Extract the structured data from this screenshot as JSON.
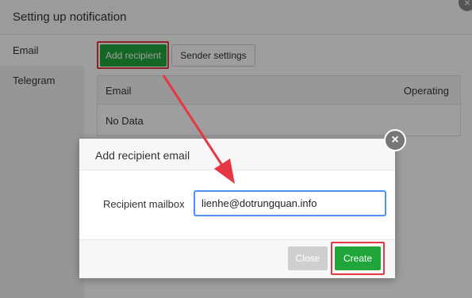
{
  "base_dialog": {
    "title": "Setting up notification",
    "close_glyph": "×",
    "sidebar": {
      "items": [
        {
          "label": "Email",
          "active": true
        },
        {
          "label": "Telegram",
          "active": false
        }
      ]
    },
    "toolbar": {
      "add_recipient_label": "Add recipient",
      "sender_settings_label": "Sender settings"
    },
    "table": {
      "columns": [
        "Email",
        "Operating"
      ],
      "empty_text": "No Data"
    }
  },
  "modal": {
    "title": "Add recipient email",
    "close_glyph": "×",
    "recipient_label": "Recipient mailbox",
    "recipient_value": "lienhe@dotrungquan.info",
    "close_button_label": "Close",
    "create_button_label": "Create"
  },
  "colors": {
    "accent_green": "#20a53a",
    "highlight_red": "#e53844",
    "focus_blue": "#4d90fe"
  }
}
